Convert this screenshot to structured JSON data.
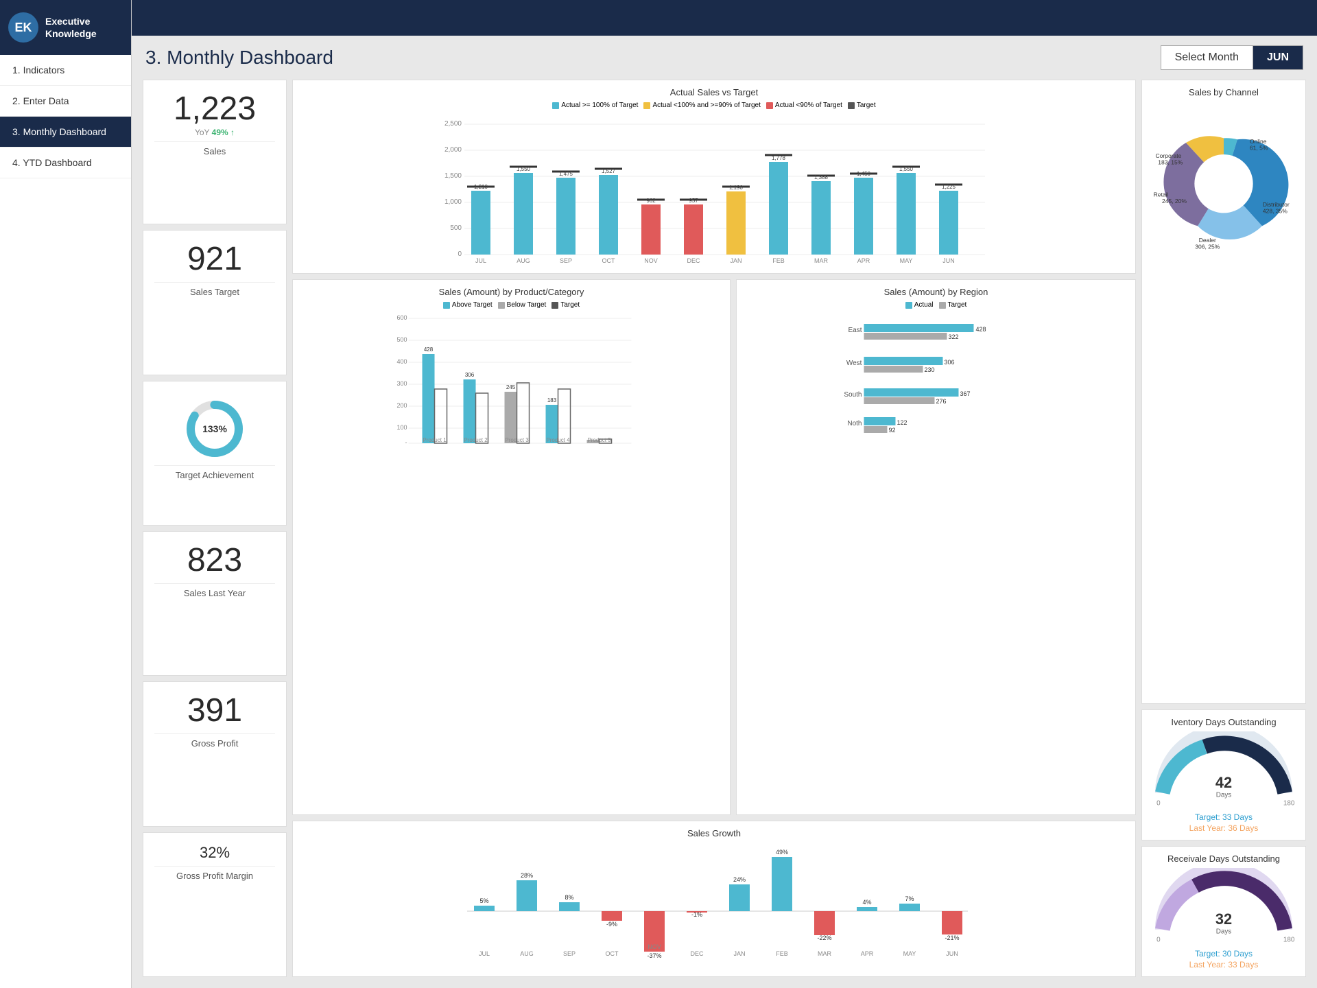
{
  "sidebar": {
    "logo": "EK",
    "brand_line1": "Executive",
    "brand_line2": "Knowledge",
    "items": [
      {
        "label": "1. Indicators",
        "active": false
      },
      {
        "label": "2. Enter Data",
        "active": false
      },
      {
        "label": "3. Monthly Dashboard",
        "active": true
      },
      {
        "label": "4. YTD Dashboard",
        "active": false
      }
    ]
  },
  "header": {
    "title": "3. Monthly Dashboard",
    "select_month_label": "Select Month",
    "selected_month": "JUN"
  },
  "kpis": [
    {
      "value": "1,223",
      "label": "Sales",
      "yoy_label": "YoY",
      "yoy_value": "49% ↑",
      "has_yoy": true
    },
    {
      "value": "921",
      "label": "Sales Target",
      "has_yoy": false
    },
    {
      "value": "133%",
      "label": "Target Achievement",
      "is_donut": true
    },
    {
      "value": "823",
      "label": "Sales Last Year",
      "has_yoy": false
    },
    {
      "value": "391",
      "label": "Gross Profit",
      "has_yoy": false
    },
    {
      "value": "32%",
      "label": "Gross Profit Margin",
      "has_yoy": false
    }
  ],
  "sales_by_product": {
    "title": "Sales (Amount) by Product/Category",
    "legend": [
      {
        "label": "Above Target",
        "color": "#4db8d0"
      },
      {
        "label": "Below Target",
        "color": "#aaa"
      },
      {
        "label": "Target",
        "color": "#555"
      }
    ],
    "bars": [
      {
        "label": "Product 1",
        "above": 428,
        "target": 260,
        "color_above": "#4db8d0",
        "color_target": "#777"
      },
      {
        "label": "Product 2",
        "above": 306,
        "target": 240,
        "color_above": "#4db8d0",
        "color_target": "#777"
      },
      {
        "label": "Product 3",
        "above": 245,
        "target": 290,
        "color_above": "#aaa",
        "color_target": "#777"
      },
      {
        "label": "Product 4",
        "above": 183,
        "target": 260,
        "color_above": "#4db8d0",
        "color_target": "#777"
      },
      {
        "label": "Product 5",
        "above": 15,
        "target": 20,
        "color_above": "#aaa",
        "color_target": "#777"
      }
    ],
    "y_max": 600
  },
  "actual_vs_target": {
    "title": "Actual Sales vs Target",
    "legend": [
      {
        "label": "Actual >= 100% of Target",
        "color": "#4db8d0"
      },
      {
        "label": "Actual <100% and >=90% of Target",
        "color": "#f0c040"
      },
      {
        "label": "Actual <90% of Target",
        "color": "#e05a5a"
      },
      {
        "label": "Target",
        "color": "#555"
      }
    ],
    "months": [
      "JUL",
      "AUG",
      "SEP",
      "OCT",
      "NOV",
      "DEC",
      "JAN",
      "FEB",
      "MAR",
      "APR",
      "MAY",
      "JUN"
    ],
    "actuals": [
      1210,
      1550,
      1475,
      1527,
      962,
      957,
      1190,
      1778,
      1388,
      1450,
      1550,
      1225
    ],
    "targets": [
      1300,
      1700,
      1600,
      1650,
      1050,
      1050,
      1300,
      1900,
      1500,
      1550,
      1700,
      1350
    ],
    "colors": [
      "#4db8d0",
      "#4db8d0",
      "#4db8d0",
      "#4db8d0",
      "#e05a5a",
      "#e05a5a",
      "#f0c040",
      "#4db8d0",
      "#4db8d0",
      "#4db8d0",
      "#4db8d0",
      "#4db8d0"
    ]
  },
  "sales_by_region": {
    "title": "Sales (Amount) by Region",
    "legend": [
      {
        "label": "Actual",
        "color": "#4db8d0"
      },
      {
        "label": "Target",
        "color": "#aaa"
      }
    ],
    "regions": [
      {
        "label": "East",
        "actual": 428,
        "target": 322
      },
      {
        "label": "West",
        "actual": 306,
        "target": 230
      },
      {
        "label": "South",
        "actual": 367,
        "target": 276
      },
      {
        "label": "Noth",
        "actual": 122,
        "target": 92
      }
    ]
  },
  "sales_by_channel": {
    "title": "Sales by Channel",
    "segments": [
      {
        "label": "Online",
        "value": 61,
        "detail": "61, 5%",
        "color": "#4db8d0"
      },
      {
        "label": "Distributor",
        "value": 428,
        "detail": "428, 35%",
        "color": "#2e86c1"
      },
      {
        "label": "Dealer",
        "value": 306,
        "detail": "306, 25%",
        "color": "#85c1e9"
      },
      {
        "label": "Retail",
        "value": 245,
        "detail": "245, 20%",
        "color": "#7d6e9e"
      },
      {
        "label": "Corporate",
        "value": 183,
        "detail": "183, 15%",
        "color": "#f0c040"
      }
    ]
  },
  "inventory_days": {
    "title": "Iventory Days Outstanding",
    "value": 42,
    "min": 0,
    "max": 180,
    "target": "Target: 33 Days",
    "last_year": "Last Year: 36 Days",
    "value_label": "Days"
  },
  "sales_growth": {
    "title": "Sales Growth",
    "months": [
      "JUL",
      "AUG",
      "SEP",
      "OCT",
      "NOV",
      "DEC",
      "JAN",
      "FEB",
      "MAR",
      "APR",
      "MAY",
      "JUN"
    ],
    "values": [
      5,
      28,
      8,
      -9,
      -37,
      -1,
      24,
      49,
      -22,
      4,
      7,
      -21
    ]
  },
  "receivable_days": {
    "title": "Receivale Days Outstanding",
    "value": 32,
    "min": 0,
    "max": 180,
    "target": "Target: 30 Days",
    "last_year": "Last Year: 33 Days",
    "value_label": "Days"
  }
}
